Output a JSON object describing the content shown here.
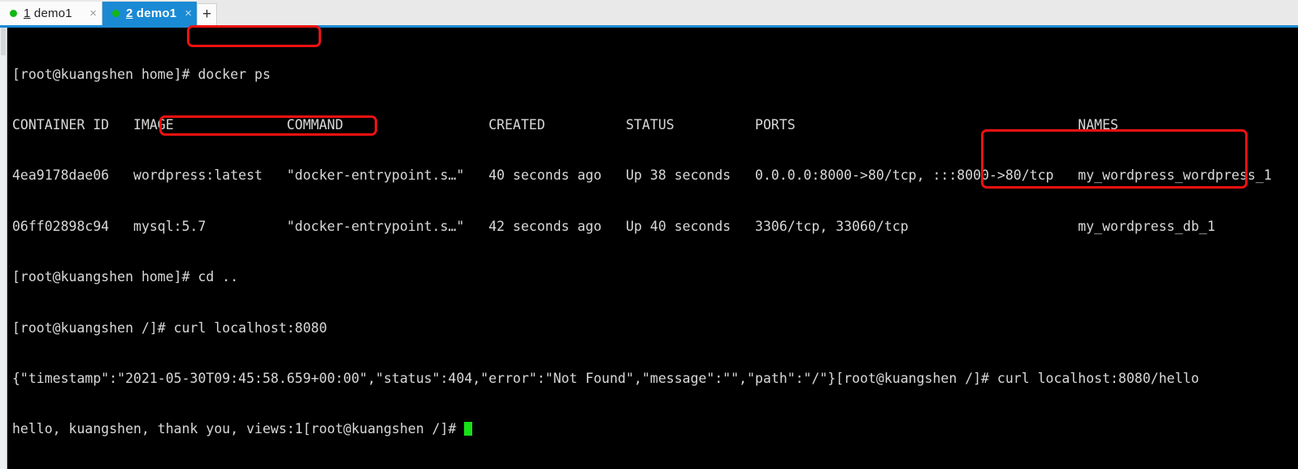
{
  "window": {
    "tabs": [
      {
        "index": "1",
        "title": " demo1",
        "status_icon": "green-dot",
        "close_icon": "×",
        "active": false
      },
      {
        "index": "2",
        "title": " demo1",
        "status_icon": "green-dot",
        "close_icon": "×",
        "active": true
      }
    ],
    "new_tab_label": "+"
  },
  "terminal": {
    "lines": [
      "[root@kuangshen home]# docker ps",
      "CONTAINER ID   IMAGE              COMMAND                  CREATED          STATUS          PORTS                                   NAMES",
      "4ea9178dae06   wordpress:latest   \"docker-entrypoint.s…\"   40 seconds ago   Up 38 seconds   0.0.0.0:8000->80/tcp, :::8000->80/tcp   my_wordpress_wordpress_1",
      "06ff02898c94   mysql:5.7          \"docker-entrypoint.s…\"   42 seconds ago   Up 40 seconds   3306/tcp, 33060/tcp                     my_wordpress_db_1",
      "[root@kuangshen home]# cd ..",
      "[root@kuangshen /]# curl localhost:8080",
      "{\"timestamp\":\"2021-05-30T09:45:58.659+00:00\",\"status\":404,\"error\":\"Not Found\",\"message\":\"\",\"path\":\"/\"}[root@kuangshen /]# curl localhost:8080/hello",
      "hello, kuangshen, thank you, views:1[root@kuangshen /]# "
    ],
    "cursor": "block-cursor",
    "colors": {
      "background": "#000000",
      "foreground": "#d8d8d8",
      "cursor": "#16e016",
      "accent": "#1a8ad4",
      "annotation": "#ee1111"
    }
  },
  "annotations": [
    {
      "id": "docker-ps",
      "label": "docker ps"
    },
    {
      "id": "curl-8080",
      "label": "curl localhost:8080"
    },
    {
      "id": "curl-hello",
      "label": "curl localhost:8080/hello"
    }
  ]
}
